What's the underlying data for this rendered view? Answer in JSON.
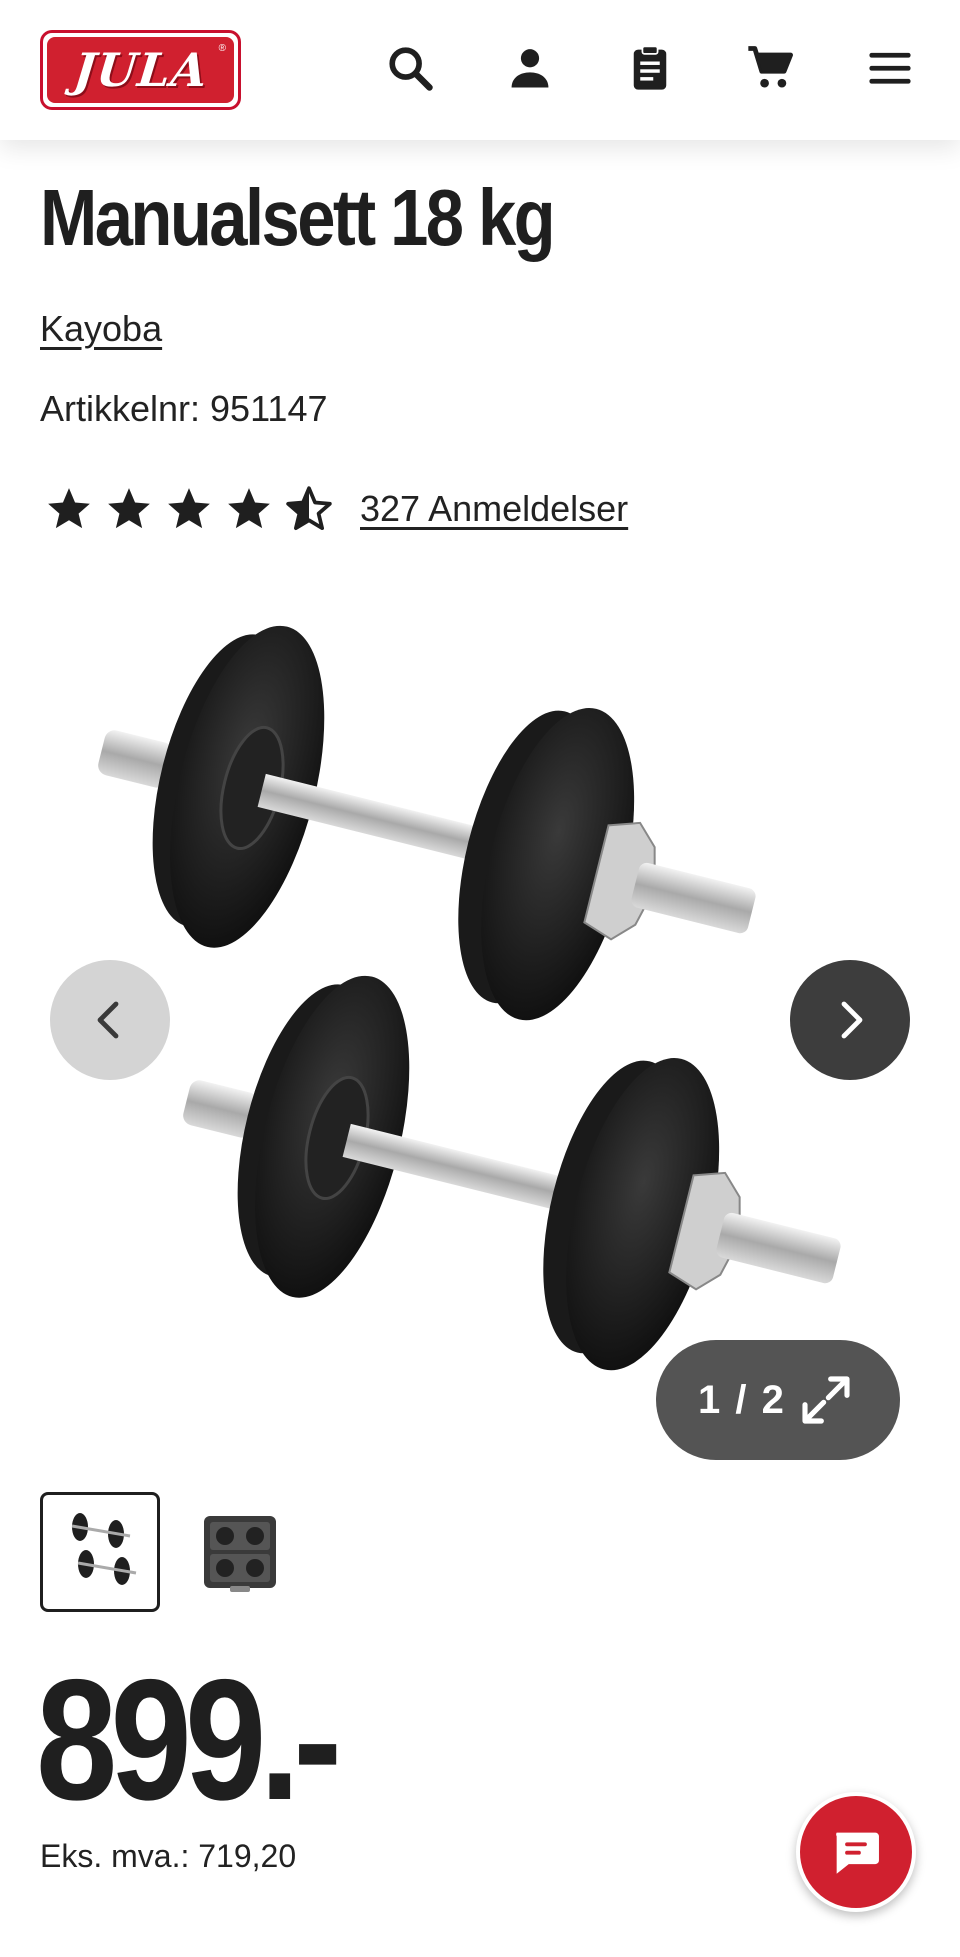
{
  "header": {
    "logo_text": "JULA",
    "logo_mark": "®",
    "icons": [
      "search-icon",
      "user-icon",
      "clipboard-icon",
      "cart-icon",
      "menu-icon"
    ]
  },
  "product": {
    "title": "Manualsett 18 kg",
    "brand": "Kayoba",
    "article_number": "Artikkelnr: 951147",
    "rating": 4.5,
    "rating_max": 5,
    "reviews": "327 Anmeldelser"
  },
  "gallery": {
    "counter": "1 / 2",
    "current": 1,
    "total": 2
  },
  "pricing": {
    "price": "899.-",
    "ex_vat": "Eks. mva.: 719,20"
  },
  "colors": {
    "brand_red": "#d0202f",
    "text": "#222222",
    "nav_dark": "#3d3d3d",
    "nav_light": "#d4d4d4"
  }
}
